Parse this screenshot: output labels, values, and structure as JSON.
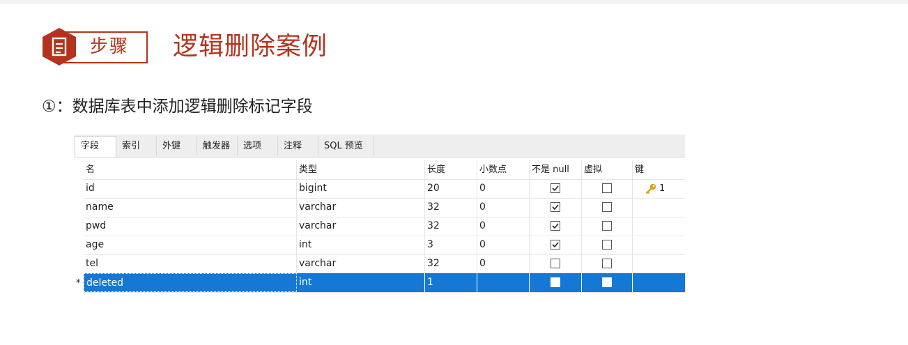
{
  "header": {
    "badge_label": "步骤",
    "title": "逻辑删除案例"
  },
  "step": {
    "text": "①：数据库表中添加逻辑删除标记字段"
  },
  "tabs": [
    "字段",
    "索引",
    "外键",
    "触发器",
    "选项",
    "注释",
    "SQL 预览"
  ],
  "columns": [
    "名",
    "类型",
    "长度",
    "小数点",
    "不是 null",
    "虚拟",
    "键"
  ],
  "rows": [
    {
      "name": "id",
      "type": "bigint",
      "length": "20",
      "decimals": "0",
      "not_null": true,
      "virtual": false,
      "key": "1"
    },
    {
      "name": "name",
      "type": "varchar",
      "length": "32",
      "decimals": "0",
      "not_null": true,
      "virtual": false,
      "key": ""
    },
    {
      "name": "pwd",
      "type": "varchar",
      "length": "32",
      "decimals": "0",
      "not_null": true,
      "virtual": false,
      "key": ""
    },
    {
      "name": "age",
      "type": "int",
      "length": "3",
      "decimals": "0",
      "not_null": true,
      "virtual": false,
      "key": ""
    },
    {
      "name": "tel",
      "type": "varchar",
      "length": "32",
      "decimals": "0",
      "not_null": false,
      "virtual": false,
      "key": ""
    },
    {
      "name": "deleted",
      "type": "int",
      "length": "1",
      "decimals": "",
      "not_null": false,
      "virtual": false,
      "key": "",
      "selected": true,
      "row_marker": "*"
    }
  ],
  "colors": {
    "accent": "#b5331e",
    "selection": "#1478d4",
    "key_icon": "#d9a21b"
  }
}
